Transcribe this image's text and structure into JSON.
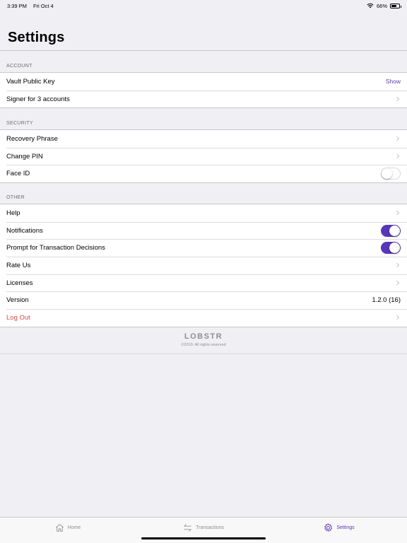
{
  "status_bar": {
    "time": "3:39 PM",
    "date": "Fri Oct 4",
    "battery": "66%",
    "battery_level": 0.66
  },
  "page": {
    "title": "Settings"
  },
  "sections": {
    "account": {
      "header": "ACCOUNT",
      "rows": [
        {
          "label": "Vault Public Key",
          "value": "Show"
        },
        {
          "label": "Signer for 3 accounts"
        }
      ]
    },
    "security": {
      "header": "SECURITY",
      "rows": [
        {
          "label": "Recovery Phrase"
        },
        {
          "label": "Change PIN"
        },
        {
          "label": "Face ID",
          "toggle": false
        }
      ]
    },
    "other": {
      "header": "OTHER",
      "rows": [
        {
          "label": "Help"
        },
        {
          "label": "Notifications",
          "toggle": true
        },
        {
          "label": "Prompt for Transaction Decisions",
          "toggle": true
        },
        {
          "label": "Rate Us"
        },
        {
          "label": "Licenses"
        },
        {
          "label": "Version",
          "value": "1.2.0 (16)"
        },
        {
          "label": "Log Out"
        }
      ]
    }
  },
  "footer": {
    "brand": "LOBSTR",
    "copyright": "©2019. All rights reserved"
  },
  "tabs": [
    {
      "label": "Home",
      "icon": "home-icon",
      "active": false
    },
    {
      "label": "Transactions",
      "icon": "transactions-icon",
      "active": false
    },
    {
      "label": "Settings",
      "icon": "gear-icon",
      "active": true
    }
  ],
  "colors": {
    "accent": "#5936b8",
    "danger": "#e0474c",
    "background": "#efeff4"
  }
}
